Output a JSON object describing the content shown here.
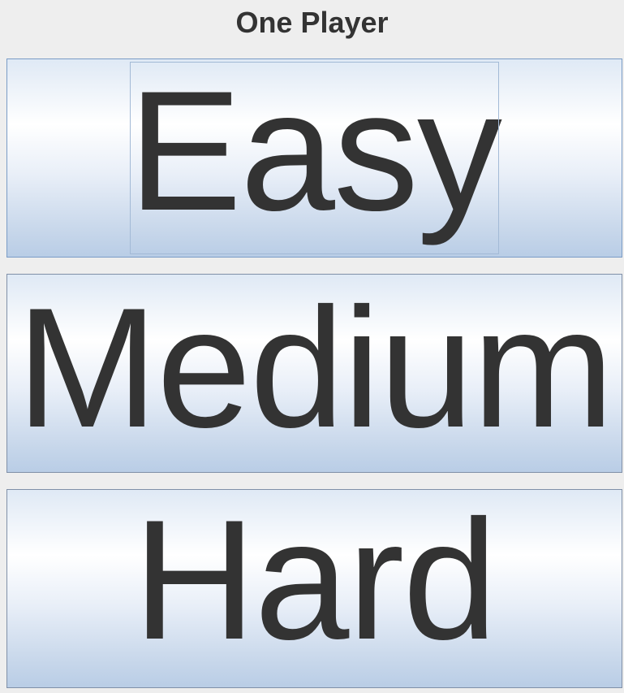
{
  "window": {
    "title": "One Player"
  },
  "difficulty": {
    "selected": "Easy",
    "options": [
      {
        "label": "Easy"
      },
      {
        "label": "Medium"
      },
      {
        "label": "Hard"
      }
    ]
  },
  "colors": {
    "background": "#eeeeee",
    "text": "#333333",
    "button_border": "#8090a8",
    "button_gradient_top": "#dfe9f5",
    "button_gradient_highlight": "#ffffff",
    "button_gradient_bottom": "#b9cde6",
    "focus_ring": "#a3bad6"
  }
}
